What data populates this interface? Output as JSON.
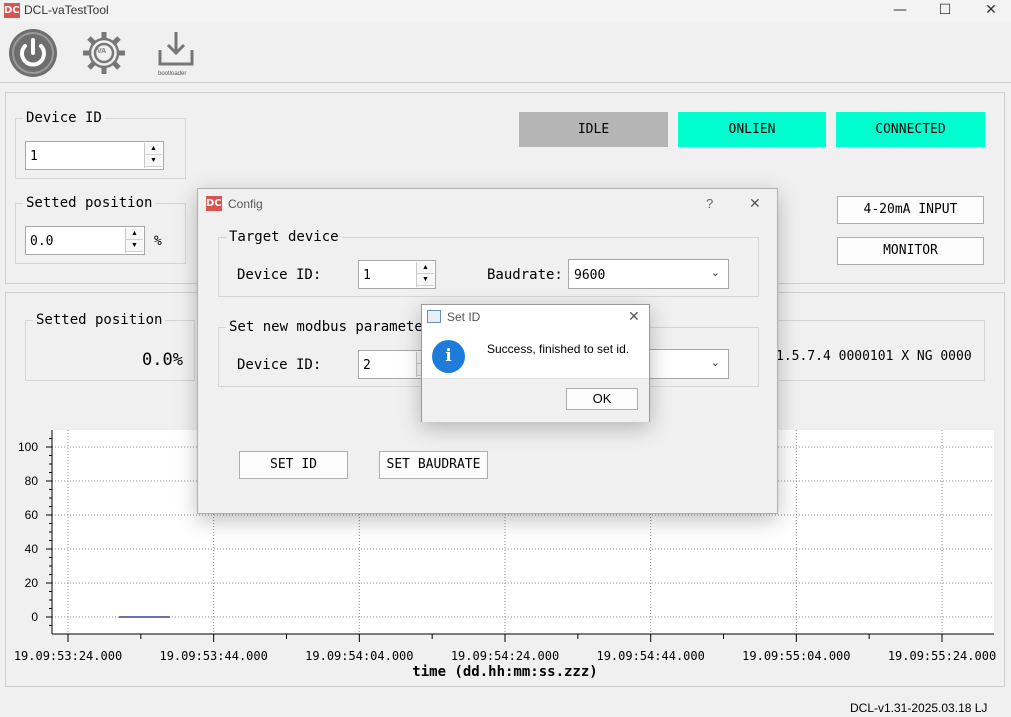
{
  "window": {
    "title": "DCL-vaTestTool",
    "logo": "DCL",
    "minimize": "—",
    "maximize": "☐",
    "close": "✕"
  },
  "toolbar": {
    "power_icon": "power-icon",
    "settings_icon": "gear-icon",
    "settings_text": "VA",
    "bootloader_icon": "download-icon",
    "bootloader_text": "bootloader"
  },
  "device": {
    "group_title": "Device ID",
    "value": "1"
  },
  "setted": {
    "group_title": "Setted position",
    "value": "0.0",
    "unit": "%"
  },
  "status": {
    "idle": {
      "label": "IDLE",
      "color": "#b5b5b5"
    },
    "online": {
      "label": "ONLIEN",
      "color": "#00ffd0"
    },
    "connected": {
      "label": "CONNECTED",
      "color": "#00ffd0"
    }
  },
  "buttons": {
    "input": "4-20mA INPUT",
    "monitor": "MONITOR"
  },
  "position_panel": {
    "group_title": "Setted position",
    "value": "0.0%"
  },
  "info_line": "1.5.7.4 0000101 X NG 0000",
  "chart_data": {
    "type": "line",
    "xlabel": "time (dd.hh:mm:ss.zzz)",
    "ylabel": "",
    "ylim": [
      -10,
      110
    ],
    "y_ticks": [
      "0",
      "20",
      "40",
      "60",
      "80",
      "100"
    ],
    "x_ticks": [
      "19.09:53:24.000",
      "19.09:53:44.000",
      "19.09:54:04.000",
      "19.09:54:24.000",
      "19.09:54:44.000",
      "19.09:55:04.000",
      "19.09:55:24.000"
    ],
    "series": [
      {
        "values": [
          {
            "x": "19.09:53:31.000",
            "y": 0
          },
          {
            "x": "19.09:53:38.000",
            "y": 0
          }
        ]
      }
    ],
    "grid": true
  },
  "config_dialog": {
    "title": "Config",
    "help": "?",
    "close": "✕",
    "target_group": "Target device",
    "target_device_label": "Device ID:",
    "target_device_value": "1",
    "baudrate_label": "Baudrate:",
    "baudrate_value": "9600",
    "new_group": "Set new modbus parameter",
    "new_device_label": "Device ID:",
    "new_device_value": "2",
    "set_id": "SET ID",
    "set_baudrate": "SET BAUDRATE"
  },
  "message_box": {
    "title": "Set ID",
    "close": "✕",
    "icon": "info-icon",
    "icon_text": "i",
    "message": "Success, finished to set id.",
    "ok": "OK"
  },
  "statusbar": {
    "version": "DCL-v1.31-2025.03.18 LJ"
  }
}
